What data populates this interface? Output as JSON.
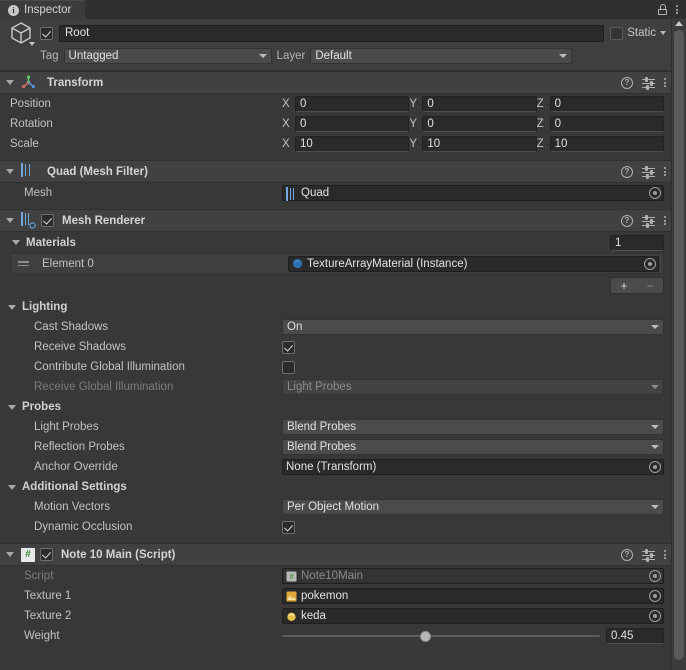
{
  "window": {
    "tab_label": "Inspector",
    "tab_icon": "info-icon",
    "lock_icon": "lock-icon",
    "menu_icon": "kebab-menu-icon"
  },
  "gameobject": {
    "icon": "cube-icon",
    "enabled": true,
    "name": "Root",
    "static_label": "Static",
    "static_checked": false,
    "tag_label": "Tag",
    "tag_value": "Untagged",
    "layer_label": "Layer",
    "layer_value": "Default"
  },
  "components": [
    {
      "id": "transform",
      "title": "Transform",
      "icon": "transform-icon",
      "expanded": true,
      "has_checkbox": false,
      "rows": [
        {
          "label": "Position",
          "x": "0",
          "y": "0",
          "z": "0"
        },
        {
          "label": "Rotation",
          "x": "0",
          "y": "0",
          "z": "0"
        },
        {
          "label": "Scale",
          "x": "10",
          "y": "10",
          "z": "10"
        }
      ],
      "axis_labels": [
        "X",
        "Y",
        "Z"
      ]
    },
    {
      "id": "mesh-filter",
      "title": "Quad (Mesh Filter)",
      "icon": "mesh-filter-icon",
      "expanded": true,
      "has_checkbox": false,
      "mesh_label": "Mesh",
      "mesh_value": "Quad"
    },
    {
      "id": "mesh-renderer",
      "title": "Mesh Renderer",
      "icon": "mesh-renderer-icon",
      "expanded": true,
      "has_checkbox": true,
      "enabled": true,
      "materials": {
        "label": "Materials",
        "count": "1",
        "element_label": "Element 0",
        "element_value": "TextureArrayMaterial (Instance)",
        "add_label": "+",
        "remove_label": "−"
      },
      "lighting": {
        "label": "Lighting",
        "cast_shadows_label": "Cast Shadows",
        "cast_shadows_value": "On",
        "receive_shadows_label": "Receive Shadows",
        "receive_shadows_checked": true,
        "contribute_gi_label": "Contribute Global Illumination",
        "contribute_gi_checked": false,
        "receive_gi_label": "Receive Global Illumination",
        "receive_gi_value": "Light Probes"
      },
      "probes": {
        "label": "Probes",
        "light_probes_label": "Light Probes",
        "light_probes_value": "Blend Probes",
        "reflection_probes_label": "Reflection Probes",
        "reflection_probes_value": "Blend Probes",
        "anchor_override_label": "Anchor Override",
        "anchor_override_value": "None (Transform)"
      },
      "additional": {
        "label": "Additional Settings",
        "motion_vectors_label": "Motion Vectors",
        "motion_vectors_value": "Per Object Motion",
        "dynamic_occlusion_label": "Dynamic Occlusion",
        "dynamic_occlusion_checked": true
      }
    },
    {
      "id": "note10main",
      "title": "Note 10 Main (Script)",
      "icon": "script-icon",
      "expanded": true,
      "has_checkbox": true,
      "enabled": true,
      "script_label": "Script",
      "script_value": "Note10Main",
      "texture1_label": "Texture 1",
      "texture1_value": "pokemon",
      "texture2_label": "Texture 2",
      "texture2_value": "keda",
      "weight_label": "Weight",
      "weight_value": "0.45",
      "weight_percent": 45
    }
  ],
  "header_icons": {
    "help": "?",
    "help_name": "help-icon",
    "preset_name": "preset-settings-icon",
    "menu_name": "kebab-menu-icon"
  },
  "colors": {
    "panel_bg": "#383838",
    "header_bg": "#414141",
    "field_bg": "#2a2a2a",
    "dropdown_bg": "#4b4b4b",
    "accent_blue": "#6ea8dc",
    "script_green": "#3a8a3a"
  },
  "scrollbar": {
    "name": "vertical-scrollbar"
  }
}
